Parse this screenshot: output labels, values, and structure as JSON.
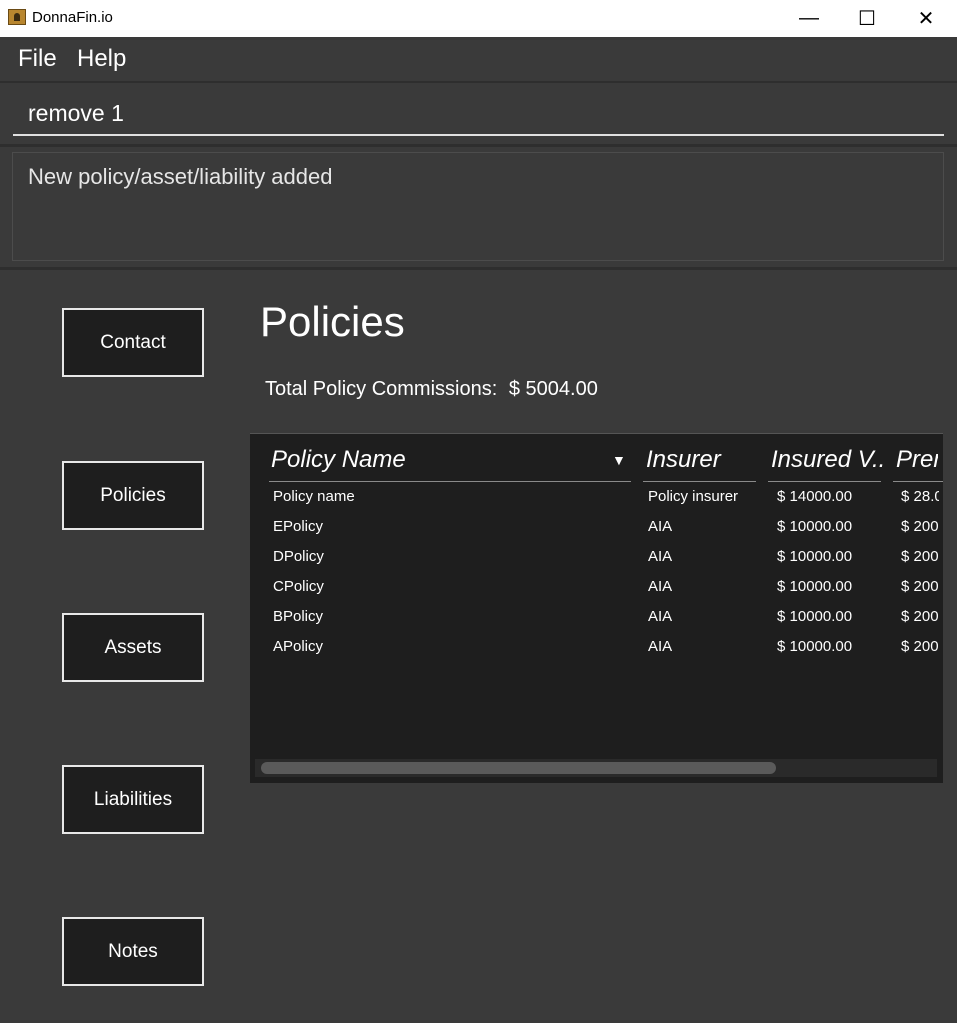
{
  "window": {
    "title": "DonnaFin.io",
    "minimize": "—",
    "maximize": "☐",
    "close": "✕"
  },
  "menu": {
    "file": "File",
    "help": "Help"
  },
  "command": {
    "value": "remove 1"
  },
  "result": {
    "message": "New policy/asset/liability added"
  },
  "nav": [
    "Contact",
    "Policies",
    "Assets",
    "Liabilities",
    "Notes"
  ],
  "page": {
    "title": "Policies",
    "commission_label": "Total Policy Commissions:",
    "commission_value": "$ 5004.00"
  },
  "table": {
    "columns": [
      "Policy Name",
      "Insurer",
      "Insured V...",
      "Prem"
    ],
    "rows": [
      [
        "Policy name",
        "Policy insurer",
        "$ 14000.00",
        "$ 28.0"
      ],
      [
        "EPolicy",
        "AIA",
        "$ 10000.00",
        "$ 200"
      ],
      [
        "DPolicy",
        "AIA",
        "$ 10000.00",
        "$ 200"
      ],
      [
        "CPolicy",
        "AIA",
        "$ 10000.00",
        "$ 200"
      ],
      [
        "BPolicy",
        "AIA",
        "$ 10000.00",
        "$ 200"
      ],
      [
        "APolicy",
        "AIA",
        "$ 10000.00",
        "$ 200"
      ]
    ]
  },
  "icons": {
    "app": "app-icon",
    "sort": "sort-descending-icon"
  }
}
